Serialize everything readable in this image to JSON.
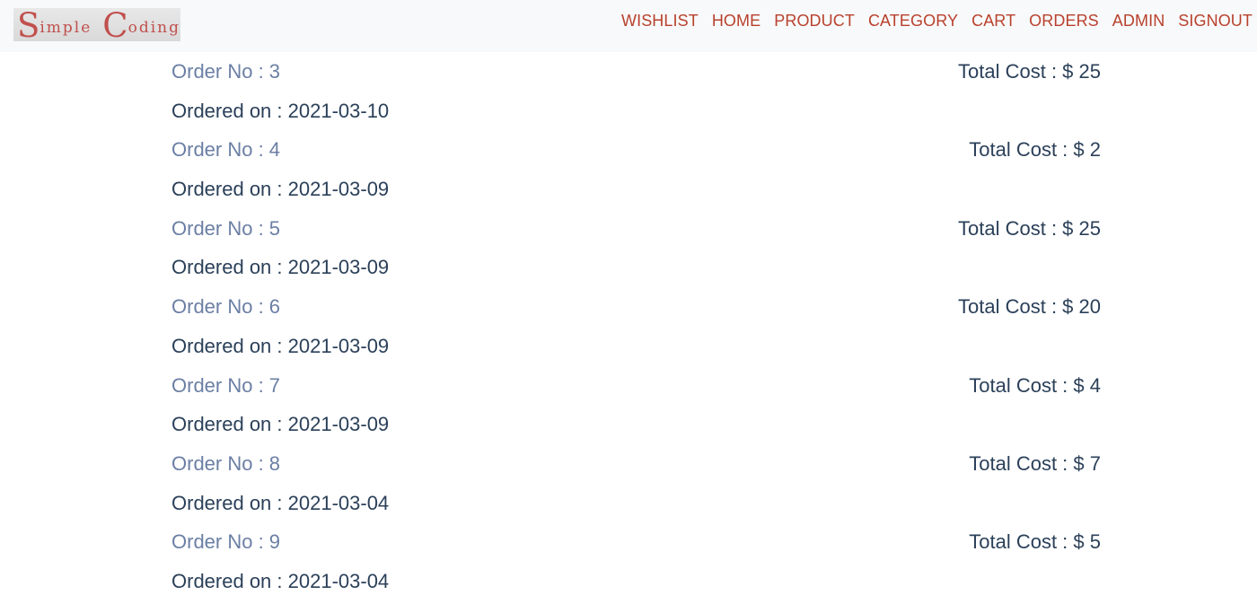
{
  "brand": {
    "logo_text_parts": [
      "S",
      "imple",
      "C",
      "oding"
    ],
    "logo_color": "#c0504d"
  },
  "nav": {
    "items": [
      {
        "label": "WISHLIST"
      },
      {
        "label": "HOME"
      },
      {
        "label": "PRODUCT"
      },
      {
        "label": "CATEGORY"
      },
      {
        "label": "CART"
      },
      {
        "label": "ORDERS"
      },
      {
        "label": "ADMIN"
      },
      {
        "label": "SIGNOUT"
      }
    ],
    "link_color": "#b8412d"
  },
  "orders": [
    {
      "order_no": "Order No : 3",
      "total": "Total Cost : $ 25",
      "ordered_on": "Ordered on : 2021-03-10"
    },
    {
      "order_no": "Order No : 4",
      "total": "Total Cost : $ 2",
      "ordered_on": "Ordered on : 2021-03-09"
    },
    {
      "order_no": "Order No : 5",
      "total": "Total Cost : $ 25",
      "ordered_on": "Ordered on : 2021-03-09"
    },
    {
      "order_no": "Order No : 6",
      "total": "Total Cost : $ 20",
      "ordered_on": "Ordered on : 2021-03-09"
    },
    {
      "order_no": "Order No : 7",
      "total": "Total Cost : $ 4",
      "ordered_on": "Ordered on : 2021-03-09"
    },
    {
      "order_no": "Order No : 8",
      "total": "Total Cost : $ 7",
      "ordered_on": "Ordered on : 2021-03-04"
    },
    {
      "order_no": "Order No : 9",
      "total": "Total Cost : $ 5",
      "ordered_on": "Ordered on : 2021-03-04"
    }
  ],
  "colors": {
    "order_no": "#6b7fa4",
    "text": "#2b4059",
    "navbar_bg": "#f8f9fa"
  }
}
